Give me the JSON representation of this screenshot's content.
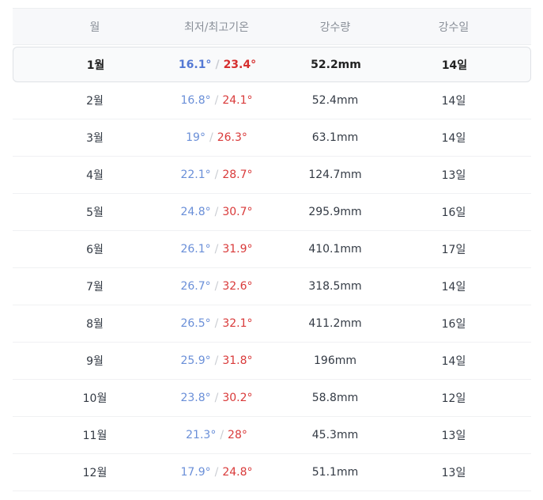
{
  "table": {
    "headers": {
      "month": "월",
      "temp": "최저/최고기온",
      "rain": "강수량",
      "days": "강수일"
    },
    "separator": "/",
    "rows": [
      {
        "month": "1월",
        "min": "16.1°",
        "max": "23.4°",
        "rain": "52.2mm",
        "days": "14일"
      },
      {
        "month": "2월",
        "min": "16.8°",
        "max": "24.1°",
        "rain": "52.4mm",
        "days": "14일"
      },
      {
        "month": "3월",
        "min": "19°",
        "max": "26.3°",
        "rain": "63.1mm",
        "days": "14일"
      },
      {
        "month": "4월",
        "min": "22.1°",
        "max": "28.7°",
        "rain": "124.7mm",
        "days": "13일"
      },
      {
        "month": "5월",
        "min": "24.8°",
        "max": "30.7°",
        "rain": "295.9mm",
        "days": "16일"
      },
      {
        "month": "6월",
        "min": "26.1°",
        "max": "31.9°",
        "rain": "410.1mm",
        "days": "17일"
      },
      {
        "month": "7월",
        "min": "26.7°",
        "max": "32.6°",
        "rain": "318.5mm",
        "days": "14일"
      },
      {
        "month": "8월",
        "min": "26.5°",
        "max": "32.1°",
        "rain": "411.2mm",
        "days": "16일"
      },
      {
        "month": "9월",
        "min": "25.9°",
        "max": "31.8°",
        "rain": "196mm",
        "days": "14일"
      },
      {
        "month": "10월",
        "min": "23.8°",
        "max": "30.2°",
        "rain": "58.8mm",
        "days": "12일"
      },
      {
        "month": "11월",
        "min": "21.3°",
        "max": "28°",
        "rain": "45.3mm",
        "days": "13일"
      },
      {
        "month": "12월",
        "min": "17.9°",
        "max": "24.8°",
        "rain": "51.1mm",
        "days": "13일"
      }
    ],
    "highlighted_row": "1월"
  },
  "colors": {
    "min_temp": "#6a8fd8",
    "max_temp": "#d93a3a",
    "header_bg": "#f7f8fa"
  }
}
